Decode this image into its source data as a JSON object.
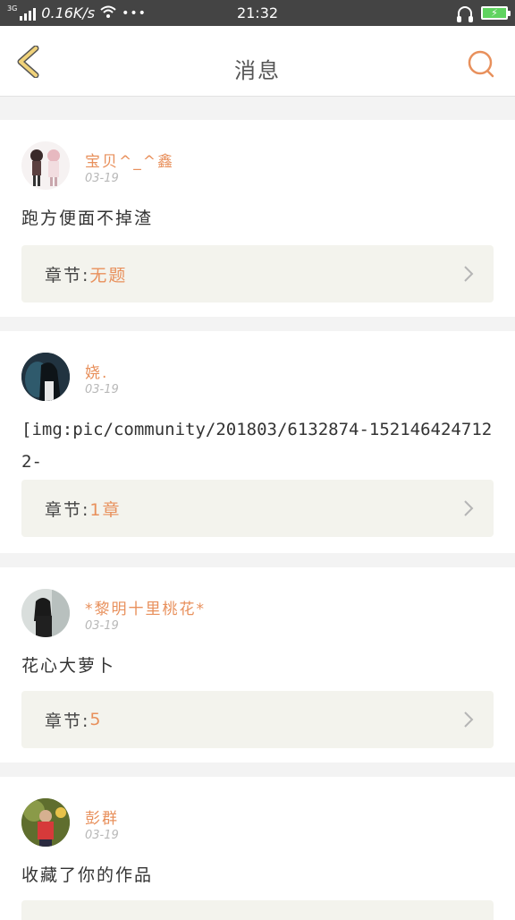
{
  "status_bar": {
    "network_type": "3G",
    "speed": "0.16K/s",
    "more": "•••",
    "time": "21:32",
    "icons": [
      "signal-icon",
      "wifi-icon",
      "headset-icon",
      "battery-charging-icon"
    ]
  },
  "header": {
    "title": "消息",
    "back_icon": "chevron-left-icon",
    "search_icon": "search-icon"
  },
  "messages": [
    {
      "username": "宝贝^_^鑫",
      "date": "03-19",
      "content": "跑方便面不掉渣",
      "chapter_label": "章节:",
      "chapter_value": "无题"
    },
    {
      "username": "娆.",
      "date": "03-19",
      "content": "[img:pic/community/201803/6132874-1521464247122-",
      "chapter_label": "章节:",
      "chapter_value": "1章"
    },
    {
      "username": "*黎明十里桃花*",
      "date": "03-19",
      "content": "花心大萝卜",
      "chapter_label": "章节:",
      "chapter_value": "5"
    },
    {
      "username": "彭群",
      "date": "03-19",
      "content": "收藏了你的作品",
      "chapter_label": "",
      "chapter_value": ""
    }
  ],
  "colors": {
    "accent": "#e8905c",
    "back_icon": "#f0d27a",
    "chapter_bg": "#f3f3ed",
    "page_bg": "#f3f3f3"
  }
}
